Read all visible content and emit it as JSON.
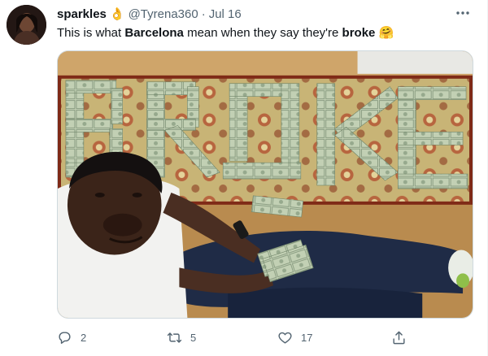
{
  "author": {
    "display_name": "sparkles",
    "name_emoji": "👌",
    "handle": "@Tyrena360",
    "separator": "·",
    "date": "Jul 16"
  },
  "more_label": "···",
  "tweet": {
    "part1": "This is what ",
    "bold1": "Barcelona",
    "part2": " mean when they say they're ",
    "bold2": "broke",
    "emoji": "🤗"
  },
  "media": {
    "money_text": "BRoKE",
    "description_icon": "photo-of-money-spelling-broke"
  },
  "actions": {
    "reply_count": "2",
    "retweet_count": "5",
    "like_count": "17"
  },
  "icons": {
    "reply": "reply-icon",
    "retweet": "retweet-icon",
    "like": "heart-icon",
    "share": "share-icon",
    "more": "more-icon"
  },
  "colors": {
    "text": "#0f1419",
    "secondary": "#536471",
    "border": "#cfd9de",
    "carpet": "#c9b57a",
    "money": "#b9c9a8"
  }
}
